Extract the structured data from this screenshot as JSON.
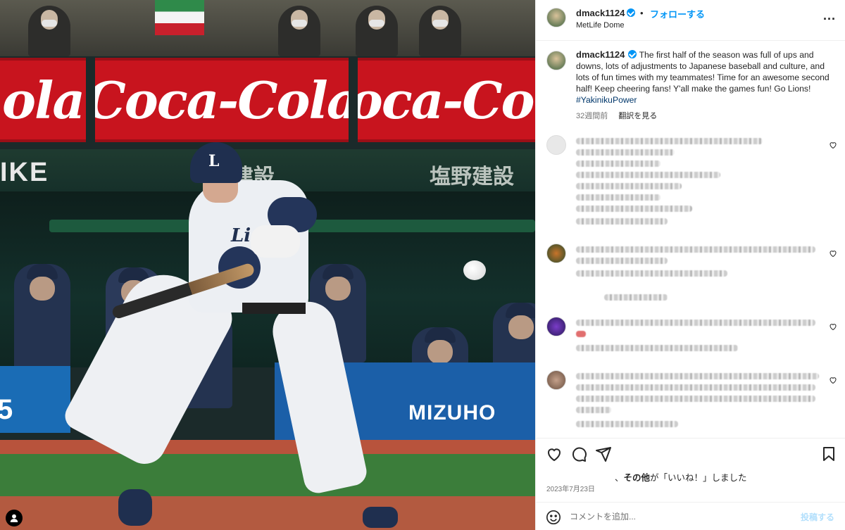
{
  "post": {
    "username": "dmack1124",
    "follow_label": "フォローする",
    "separator": "•",
    "location": "MetLife Dome",
    "more_label": "..."
  },
  "caption": {
    "username": "dmack1124",
    "text": "The first half of the season was full of ups and downs, lots of adjustments to Japanese baseball and culture, and lots of fun times with my teammates! Time for an awesome second half! Keep cheering fans! Y'all make the games fun! Go Lions!",
    "hashtag": "#YakinikuPower",
    "time_ago": "32週間前",
    "translate_label": "翻訳を見る"
  },
  "photo": {
    "ad_text": "Coca-Cola",
    "ad_text_short": "ola",
    "sponsor_nike": "IKE",
    "sponsor_jp_1": "野建設",
    "sponsor_jp_2": "塩野建設",
    "helmet_logo": "L",
    "jersey_text": "Lions",
    "wall_sponsor": "MIZUHO",
    "wall_number": "5"
  },
  "engagement": {
    "likes_prefix": "、",
    "likes_bold": "その他",
    "likes_suffix": "が「いいね！」しました",
    "date": "2023年7月23日"
  },
  "comment_box": {
    "placeholder": "コメントを追加...",
    "post_label": "投稿する"
  },
  "colors": {
    "accent": "#0095f6",
    "hashtag": "#00376b",
    "coke_red": "#c8141e",
    "mizuho_blue": "#1b5fa8"
  }
}
